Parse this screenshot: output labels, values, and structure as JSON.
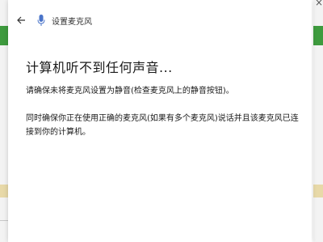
{
  "window": {
    "title": "设置麦克风"
  },
  "content": {
    "heading": "计算机听不到任何声音...",
    "instruction_1": "请确保未将麦克风设置为静音(检查麦克风上的静音按钮)。",
    "instruction_2": "同时确保你正在使用正确的麦克风(如果有多个麦克风)说话并且该麦克风已连接到你的计算机。"
  },
  "icons": {
    "back": "back-arrow-icon",
    "title": "microphone-icon",
    "close": "close-icon"
  },
  "colors": {
    "background": "#ffffff",
    "text": "#1a1a1a",
    "background_accent_green": "#3e9b3e"
  }
}
